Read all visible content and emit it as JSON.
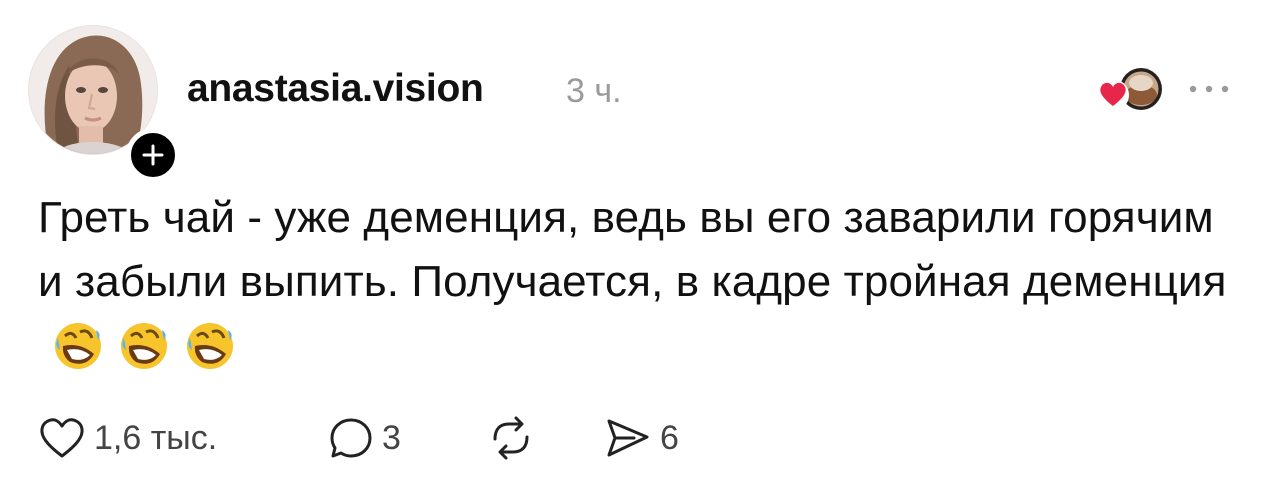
{
  "post": {
    "author": "anastasia.vision",
    "time": "3 ч.",
    "text": "Греть чай - уже деменция, ведь вы его заварили горячим и забыли выпить. Получается, в кадре тройная деменция",
    "emojis": [
      "rolling-on-floor-laughing",
      "rolling-on-floor-laughing",
      "rolling-on-floor-laughing"
    ]
  },
  "actions": {
    "likes": "1,6 тыс.",
    "comments": "3",
    "shares": "6"
  },
  "colors": {
    "heart": "#e8254a",
    "text": "#111111",
    "muted": "#9a9a9a"
  },
  "icons": {
    "follow": "plus-icon",
    "more": "ellipsis-icon",
    "like": "heart-outline-icon",
    "comment": "speech-bubble-icon",
    "repost": "repost-arrows-icon",
    "share": "send-icon"
  }
}
